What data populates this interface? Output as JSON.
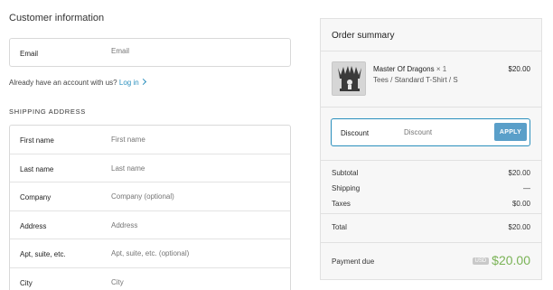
{
  "customer": {
    "title": "Customer information",
    "email": {
      "label": "Email",
      "placeholder": "Email"
    },
    "account_prompt": "Already have an account with us?",
    "login_link": "Log in"
  },
  "shipping": {
    "title": "SHIPPING ADDRESS",
    "fields": [
      {
        "label": "First name",
        "placeholder": "First name"
      },
      {
        "label": "Last name",
        "placeholder": "Last name"
      },
      {
        "label": "Company",
        "placeholder": "Company (optional)"
      },
      {
        "label": "Address",
        "placeholder": "Address"
      },
      {
        "label": "Apt, suite, etc.",
        "placeholder": "Apt, suite, etc. (optional)"
      },
      {
        "label": "City",
        "placeholder": "City"
      }
    ]
  },
  "summary": {
    "title": "Order summary",
    "item": {
      "name": "Master Of Dragons",
      "qty": "× 1",
      "variant": "Tees / Standard T-Shirt / S",
      "price": "$20.00"
    },
    "discount": {
      "label": "Discount",
      "placeholder": "Discount",
      "apply": "APPLY"
    },
    "subtotal": {
      "label": "Subtotal",
      "value": "$20.00"
    },
    "shipping": {
      "label": "Shipping",
      "value": "—"
    },
    "taxes": {
      "label": "Taxes",
      "value": "$0.00"
    },
    "total": {
      "label": "Total",
      "value": "$20.00"
    },
    "payment_due": {
      "label": "Payment due",
      "currency": "USD",
      "value": "$20.00"
    }
  },
  "colors": {
    "link": "#2a8fbd",
    "apply_button": "#5a9fc9",
    "amount_due": "#7ab356"
  }
}
